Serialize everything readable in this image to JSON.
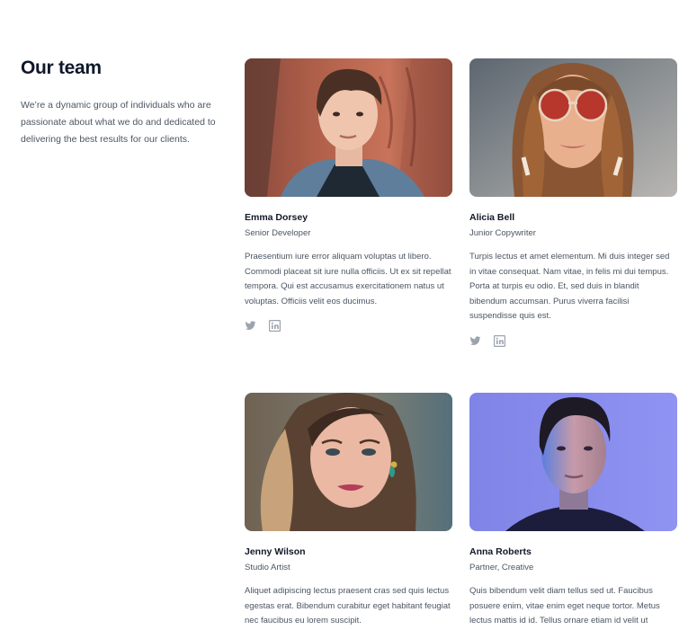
{
  "section": {
    "title": "Our team",
    "description": "We’re a dynamic group of individuals who are passionate about what we do and dedicated to delivering the best results for our clients."
  },
  "team": [
    {
      "name": "Emma Dorsey",
      "role": "Senior Developer",
      "bio": "Praesentium iure error aliquam voluptas ut libero. Commodi placeat sit iure nulla officiis. Ut ex sit repellat tempora. Qui est accusamus exercitationem natus ut voluptas. Officiis velit eos ducimus.",
      "social": [
        "twitter-icon",
        "linkedin-icon"
      ]
    },
    {
      "name": "Alicia Bell",
      "role": "Junior Copywriter",
      "bio": "Turpis lectus et amet elementum. Mi duis integer sed in vitae consequat. Nam vitae, in felis mi dui tempus. Porta at turpis eu odio. Et, sed duis in blandit bibendum accumsan. Purus viverra facilisi suspendisse quis est.",
      "social": [
        "twitter-icon",
        "linkedin-icon"
      ]
    },
    {
      "name": "Jenny Wilson",
      "role": "Studio Artist",
      "bio": "Aliquet adipiscing lectus praesent cras sed quis lectus egestas erat. Bibendum curabitur eget habitant feugiat nec faucibus eu lorem suscipit."
    },
    {
      "name": "Anna Roberts",
      "role": "Partner, Creative",
      "bio": "Quis bibendum velit diam tellus sed ut. Faucibus posuere enim, vitae enim eget neque tortor. Metus lectus mattis id id. Tellus ornare etiam id velit ut"
    }
  ],
  "colors": {
    "heading": "#0f172a",
    "body_text": "#4b5563",
    "icon": "#9ca3af"
  }
}
